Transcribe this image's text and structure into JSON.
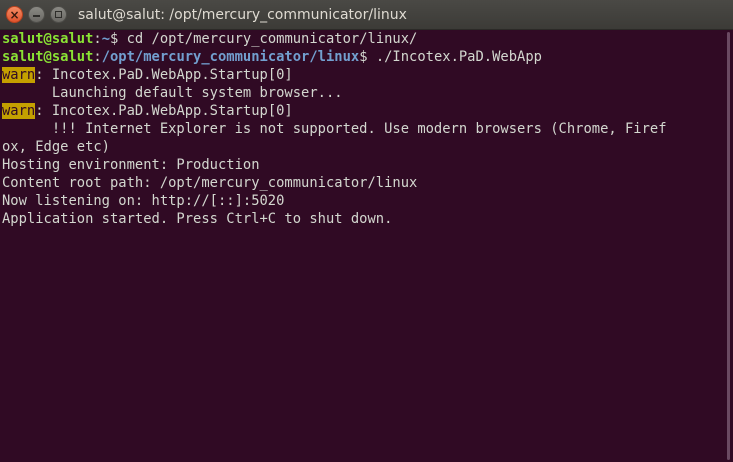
{
  "window": {
    "title": "salut@salut: /opt/mercury_communicator/linux",
    "close_glyph": "×",
    "controls": [
      "close-icon",
      "minimize-icon",
      "maximize-icon"
    ]
  },
  "terminal": {
    "colors": {
      "background": "#300a24",
      "text": "#d3d7cf",
      "prompt_user": "#8ae234",
      "prompt_path": "#729fcf",
      "warn_bg": "#c4a000"
    },
    "prompts": [
      {
        "user": "salut@salut",
        "colon": ":",
        "path": "~",
        "dollar": "$ ",
        "command": "cd /opt/mercury_communicator/linux/"
      },
      {
        "user": "salut@salut",
        "colon": ":",
        "path": "/opt/mercury_communicator/linux",
        "dollar": "$ ",
        "command": "./Incotex.PaD.WebApp"
      }
    ],
    "warns": [
      {
        "label": "warn",
        "text": ": Incotex.PaD.WebApp.Startup[0]"
      },
      {
        "label": "warn",
        "text": ": Incotex.PaD.WebApp.Startup[0]"
      }
    ],
    "lines": [
      "      Launching default system browser...",
      "      !!! Internet Explorer is not supported. Use modern browsers (Chrome, Firef",
      "ox, Edge etc)",
      "Hosting environment: Production",
      "Content root path: /opt/mercury_communicator/linux",
      "Now listening on: http://[::]:5020",
      "Application started. Press Ctrl+C to shut down."
    ]
  }
}
